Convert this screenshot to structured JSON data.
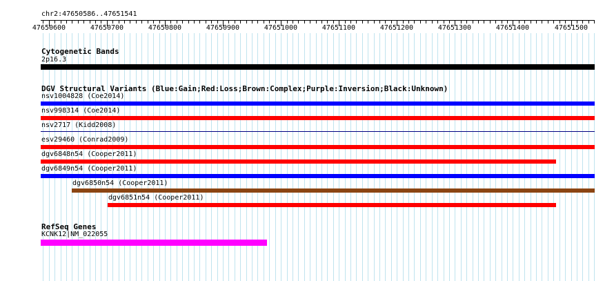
{
  "genome_browser": {
    "region_label": "chr2:47650586..47651541",
    "ruler": {
      "start": 47650586,
      "end": 47651541,
      "tick_labels": [
        "47650600",
        "47650700",
        "47650800",
        "47650900",
        "47651000",
        "47651100",
        "47651200",
        "47651300",
        "47651400",
        "47651500"
      ]
    },
    "tracks": {
      "cytobands": {
        "title": "Cytogenetic Bands",
        "features": [
          {
            "label": "2p16.3",
            "start": 47650586,
            "end": 47651541,
            "color": "#000000"
          }
        ]
      },
      "dgv": {
        "title": "DGV Structural Variants (Blue:Gain;Red:Loss;Brown:Complex;Purple:Inversion;Black:Unknown)",
        "features": [
          {
            "label": "nsv1004828 (Coe2014)",
            "start": 47650586,
            "end": 47651541,
            "color": "#0000ff",
            "kind": "thick"
          },
          {
            "label": "nsv998314 (Coe2014)",
            "start": 47650586,
            "end": 47651541,
            "color": "#ff0000",
            "kind": "thick"
          },
          {
            "label": "nsv2717 (Kidd2008)",
            "start": 47650586,
            "end": 47651541,
            "color": "#000080",
            "kind": "thin"
          },
          {
            "label": "esv29460 (Conrad2009)",
            "start": 47650586,
            "end": 47651541,
            "color": "#ff0000",
            "kind": "thick"
          },
          {
            "label": "dgv6848n54 (Cooper2011)",
            "start": 47650586,
            "end": 47651474,
            "color": "#ff0000",
            "kind": "thick"
          },
          {
            "label": "dgv6849n54 (Cooper2011)",
            "start": 47650586,
            "end": 47651541,
            "color": "#0000ff",
            "kind": "thick"
          },
          {
            "label": "dgv6850n54 (Cooper2011)",
            "start": 47650640,
            "end": 47651541,
            "color": "#8b4513",
            "kind": "thick"
          },
          {
            "label": "dgv6851n54 (Cooper2011)",
            "start": 47650701,
            "end": 47651474,
            "color": "#ff0000",
            "kind": "thick"
          }
        ]
      },
      "refseq": {
        "title": "RefSeq Genes",
        "features": [
          {
            "label": "KCNK12|NM_022055",
            "start": 47650586,
            "end": 47650976,
            "color": "#ff00ff",
            "kind": "gene"
          }
        ]
      }
    }
  }
}
